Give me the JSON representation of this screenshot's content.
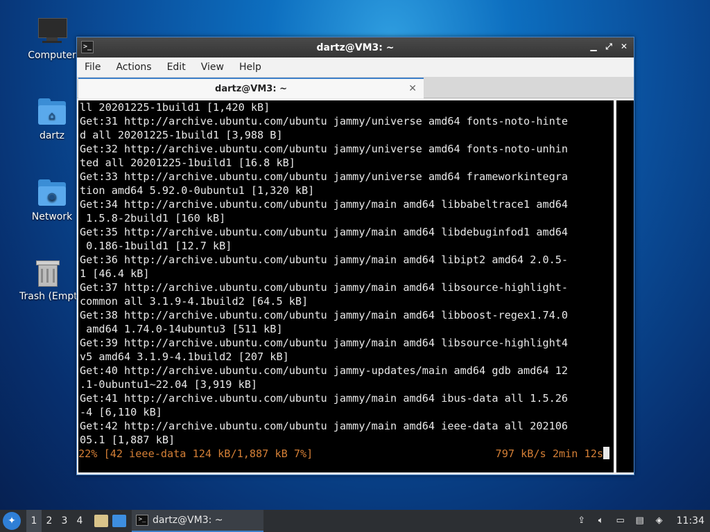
{
  "desktop": {
    "icons": [
      {
        "label": "Computer"
      },
      {
        "label": "dartz"
      },
      {
        "label": "Network"
      },
      {
        "label": "Trash (Empty)"
      }
    ]
  },
  "window": {
    "title": "dartz@VM3: ~",
    "menu": [
      "File",
      "Actions",
      "Edit",
      "View",
      "Help"
    ],
    "tab_title": "dartz@VM3: ~",
    "tab_close": "✕"
  },
  "terminal": {
    "lines": [
      "ll 20201225-1build1 [1,420 kB]",
      "Get:31 http://archive.ubuntu.com/ubuntu jammy/universe amd64 fonts-noto-hinte",
      "d all 20201225-1build1 [3,988 B]",
      "Get:32 http://archive.ubuntu.com/ubuntu jammy/universe amd64 fonts-noto-unhin",
      "ted all 20201225-1build1 [16.8 kB]",
      "Get:33 http://archive.ubuntu.com/ubuntu jammy/universe amd64 frameworkintegra",
      "tion amd64 5.92.0-0ubuntu1 [1,320 kB]",
      "Get:34 http://archive.ubuntu.com/ubuntu jammy/main amd64 libbabeltrace1 amd64",
      " 1.5.8-2build1 [160 kB]",
      "Get:35 http://archive.ubuntu.com/ubuntu jammy/main amd64 libdebuginfod1 amd64",
      " 0.186-1build1 [12.7 kB]",
      "Get:36 http://archive.ubuntu.com/ubuntu jammy/main amd64 libipt2 amd64 2.0.5-",
      "1 [46.4 kB]",
      "Get:37 http://archive.ubuntu.com/ubuntu jammy/main amd64 libsource-highlight-",
      "common all 3.1.9-4.1build2 [64.5 kB]",
      "Get:38 http://archive.ubuntu.com/ubuntu jammy/main amd64 libboost-regex1.74.0",
      " amd64 1.74.0-14ubuntu3 [511 kB]",
      "Get:39 http://archive.ubuntu.com/ubuntu jammy/main amd64 libsource-highlight4",
      "v5 amd64 3.1.9-4.1build2 [207 kB]",
      "Get:40 http://archive.ubuntu.com/ubuntu jammy-updates/main amd64 gdb amd64 12",
      ".1-0ubuntu1~22.04 [3,919 kB]",
      "Get:41 http://archive.ubuntu.com/ubuntu jammy/main amd64 ibus-data all 1.5.26",
      "-4 [6,110 kB]",
      "Get:42 http://archive.ubuntu.com/ubuntu jammy/main amd64 ieee-data all 202106",
      "05.1 [1,887 kB]"
    ],
    "status_left": "22% [42 ieee-data 124 kB/1,887 kB 7%]",
    "status_right": "797 kB/s 2min 12s",
    "status_color": "#d47f36"
  },
  "taskbar": {
    "workspaces": [
      "1",
      "2",
      "3",
      "4"
    ],
    "active_workspace": "1",
    "task_label": "dartz@VM3: ~",
    "clock": "11:34",
    "tray_icons": [
      "updates-icon",
      "volume-icon",
      "network-icon",
      "clipboard-icon",
      "notification-icon"
    ]
  }
}
